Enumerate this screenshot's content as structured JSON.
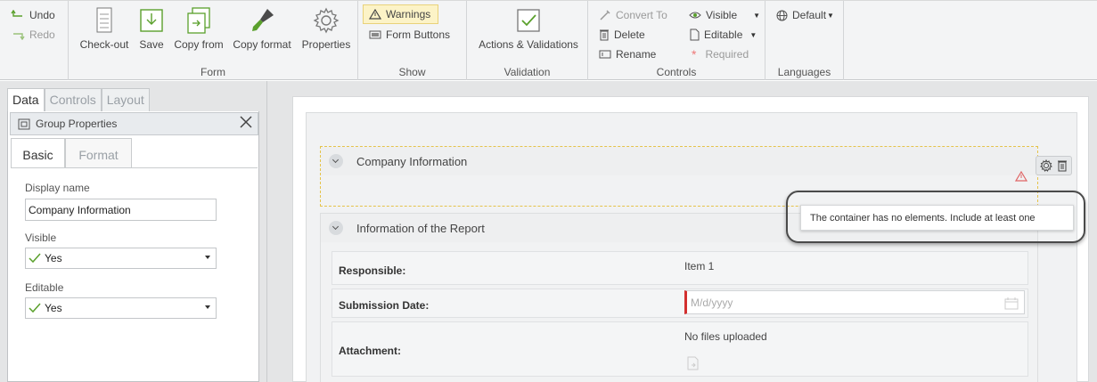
{
  "ribbon": {
    "undo": "Undo",
    "redo": "Redo",
    "form": {
      "label": "Form",
      "buttons": [
        "Check-out",
        "Save",
        "Copy from",
        "Copy format",
        "Properties"
      ]
    },
    "show": {
      "label": "Show",
      "warnings": "Warnings",
      "form_buttons": "Form Buttons"
    },
    "validation": {
      "label": "Validation",
      "actions": "Actions & Validations"
    },
    "controls": {
      "label": "Controls",
      "convert_to": "Convert To",
      "delete": "Delete",
      "rename": "Rename",
      "visible": "Visible",
      "editable": "Editable",
      "required": "Required"
    },
    "languages": {
      "label": "Languages",
      "default": "Default"
    }
  },
  "left": {
    "tabs": [
      "Data",
      "Controls",
      "Layout"
    ],
    "panel_title": "Group Properties",
    "subtabs": [
      "Basic",
      "Format"
    ],
    "display_name_label": "Display name",
    "display_name_value": "Company Information",
    "visible_label": "Visible",
    "visible_value": "Yes",
    "editable_label": "Editable",
    "editable_value": "Yes"
  },
  "canvas": {
    "group1_title": "Company Information",
    "tooltip": "The container has no elements. Include at least one",
    "group2_title": "Information of the Report",
    "rows": [
      {
        "label": "Responsible:",
        "value": "Item 1"
      },
      {
        "label": "Submission Date:",
        "placeholder": "M/d/yyyy"
      },
      {
        "label": "Attachment:",
        "value": "No files uploaded"
      }
    ]
  },
  "colors": {
    "accent_green": "#5aa02c",
    "required_red": "#d32f2f",
    "warning_yellow": "#fcf3c7"
  }
}
